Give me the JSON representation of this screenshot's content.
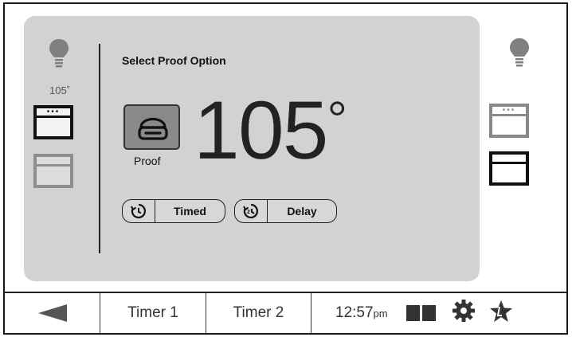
{
  "left_column": {
    "small_temp": "105˚"
  },
  "panel": {
    "title": "Select Proof Option",
    "mode_label": "Proof",
    "temperature": "105",
    "degree": "°",
    "options": [
      {
        "label": "Timed",
        "icon": "timer-icon"
      },
      {
        "label": "Delay",
        "icon": "delay-icon"
      }
    ]
  },
  "bottom_bar": {
    "back_icon": "back-arrow-icon",
    "timer1_label": "Timer 1",
    "timer2_label": "Timer 2",
    "clock_time": "12:57",
    "clock_suffix": "pm",
    "icons": [
      "dual-oven-icon",
      "gear-icon",
      "star-icon"
    ]
  },
  "colors": {
    "panel_bg": "#d2d2d2",
    "tile_bg": "#8a8a8a",
    "ink": "#111111",
    "muted": "#8e8e8e"
  }
}
